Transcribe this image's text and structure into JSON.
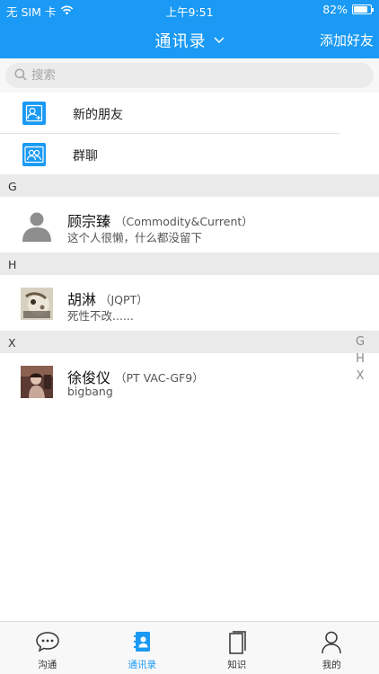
{
  "status_bar": {
    "carrier": "无 SIM 卡",
    "time": "上午9:51",
    "battery": "82%",
    "battery_level": 0.82
  },
  "header": {
    "title": "通讯录",
    "right_action": "添加好友"
  },
  "search": {
    "placeholder": "搜索"
  },
  "quick_entries": [
    {
      "label": "新的朋友",
      "icon": "add-user-icon"
    },
    {
      "label": "群聊",
      "icon": "group-icon"
    }
  ],
  "sections": [
    {
      "letter": "G",
      "contacts": [
        {
          "name": "顾宗臻",
          "sub": "（Commodity&Current）",
          "signature": "这个人很懒，什么都没留下"
        }
      ]
    },
    {
      "letter": "H",
      "contacts": [
        {
          "name": "胡淋",
          "sub": "（JQPT）",
          "signature": "死性不改......"
        }
      ]
    },
    {
      "letter": "X",
      "contacts": [
        {
          "name": "徐俊仪",
          "sub": "（PT VAC-GF9）",
          "signature": "bigbang"
        }
      ]
    }
  ],
  "index_letters": [
    "G",
    "H",
    "X"
  ],
  "tabs": [
    {
      "label": "沟通",
      "icon": "chat-bubble-icon"
    },
    {
      "label": "通讯录",
      "icon": "contacts-book-icon",
      "active": true
    },
    {
      "label": "知识",
      "icon": "book-icon"
    },
    {
      "label": "我的",
      "icon": "person-icon"
    }
  ],
  "colors": {
    "accent": "#1a9af4",
    "section_bg": "#eaeaea",
    "tabbar_bg": "#f8f8f8"
  }
}
